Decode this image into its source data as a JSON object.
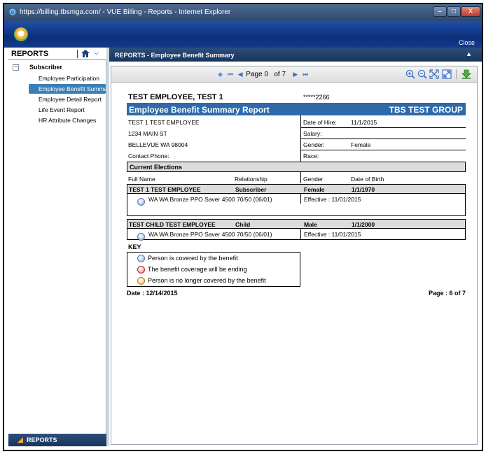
{
  "window": {
    "title": "https://billing.tbsmga.com/ - VUE Billing - Reports - Internet Explorer",
    "controls": {
      "minimize": "–",
      "maximize": "□",
      "close": "X"
    }
  },
  "app_header": {
    "close_label": "Close"
  },
  "sidebar": {
    "title": "REPORTS",
    "group_label": "Subscriber",
    "toggle_symbol": "–",
    "items": [
      {
        "label": "Employee Participation",
        "active": false
      },
      {
        "label": "Employee Benefit Summary",
        "active": true
      },
      {
        "label": "Employee Detail Report",
        "active": false
      },
      {
        "label": "Life Event Report",
        "active": false
      },
      {
        "label": "HR Attribute Changes",
        "active": false
      }
    ],
    "footer_label": "REPORTS"
  },
  "main": {
    "header_title": "REPORTS - Employee Benefit Summary"
  },
  "toolbar": {
    "page_label": "Page",
    "current_page": "0",
    "of_label": "of 7"
  },
  "report": {
    "employee_name": "TEST EMPLOYEE, TEST 1",
    "ssn": "*****2266",
    "title": "Employee Benefit Summary Report",
    "group": "TBS TEST GROUP",
    "address": {
      "name": "TEST 1 TEST EMPLOYEE",
      "street": "1234 MAIN ST",
      "city": "BELLEVUE WA  98004",
      "contact_label": "Contact Phone:"
    },
    "details": {
      "hire_label": "Date of Hire:",
      "hire_value": "11/1/2015",
      "salary_label": "Salary:",
      "gender_label": "Gender:",
      "gender_value": "Female",
      "race_label": "Race:"
    },
    "elections_title": "Current Elections",
    "columns": {
      "name": "Full Name",
      "relationship": "Relationship",
      "gender": "Gender",
      "dob": "Date of Birth"
    },
    "persons": [
      {
        "name": "TEST 1 TEST EMPLOYEE",
        "relationship": "Subscriber",
        "gender": "Female",
        "dob": "1/1/1970",
        "plan": "WA WA Bronze PPO Saver 4500 70/50 (06/01)",
        "effective": "Effective : 11/01/2015"
      },
      {
        "name": "TEST CHILD TEST EMPLOYEE",
        "relationship": "Child",
        "gender": "Male",
        "dob": "1/1/2000",
        "plan": "WA WA Bronze PPO Saver 4500 70/50 (06/01)",
        "effective": "Effective : 11/01/2015"
      }
    ],
    "key": {
      "title": "KEY",
      "items": [
        "Person is covered by the benefit",
        "The benefit coverage will be ending",
        "Person is no longer covered by the benefit"
      ]
    },
    "footer": {
      "date": "Date : 12/14/2015",
      "page": "Page : 6 of 7"
    }
  },
  "colors": {
    "report_title_bar": "#2e6aa8",
    "active_item": "#3c7fb5",
    "panel_header": "#17345c"
  }
}
